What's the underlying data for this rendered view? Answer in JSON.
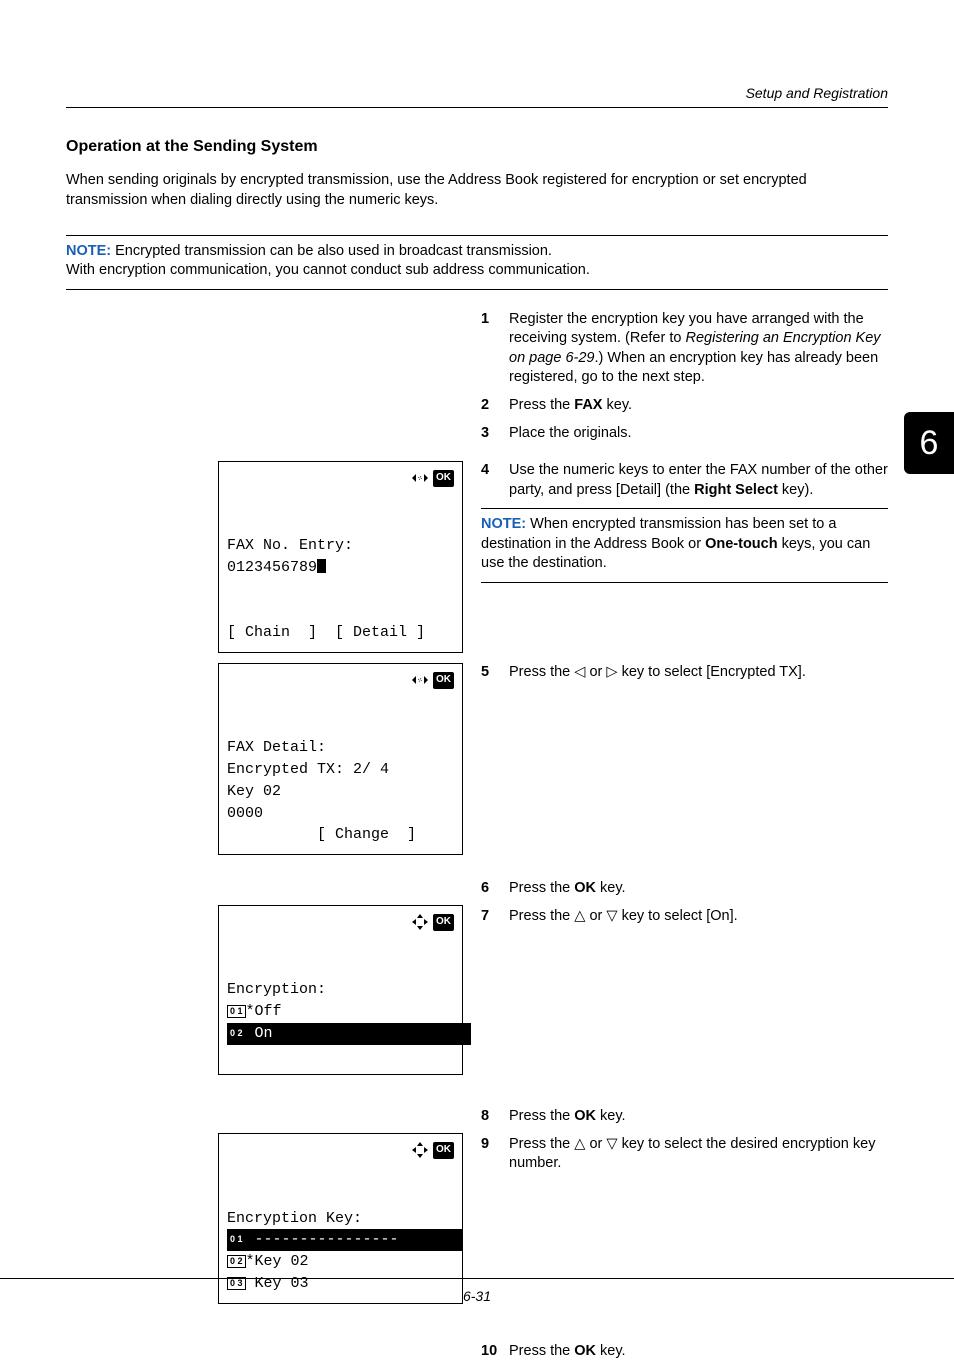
{
  "header": {
    "running_title": "Setup and Registration"
  },
  "tab": {
    "number": "6"
  },
  "section": {
    "title": "Operation at the Sending System"
  },
  "intro": "When sending originals by encrypted transmission, use the Address Book registered for encryption or set encrypted transmission when dialing directly using the numeric keys.",
  "note1": {
    "label": "NOTE:",
    "line1": " Encrypted transmission can be also used in broadcast transmission.",
    "line2": "With encryption communication, you cannot conduct sub address communication."
  },
  "steps": {
    "s1a": "Register the encryption key you have arranged with the receiving system. (Refer to ",
    "s1b": "Registering an Encryption Key on page 6-29",
    "s1c": ".) When an encryption key has already been registered, go to the next step.",
    "s2a": "Press the ",
    "s2b": "FAX",
    "s2c": " key.",
    "s3": "Place the originals.",
    "s4a": "Use the numeric keys to enter the FAX number of the other party, and press [Detail] (the ",
    "s4b": "Right Select",
    "s4c": " key).",
    "s5a": "Press the ",
    "s5b": " or ",
    "s5c": " key to select [Encrypted TX].",
    "s6a": "Press the ",
    "s6b": "OK",
    "s6c": " key.",
    "s7a": "Press the ",
    "s7b": " or ",
    "s7c": " key to select [On].",
    "s8a": "Press the ",
    "s8b": "OK",
    "s8c": " key.",
    "s9a": "Press the ",
    "s9b": " or ",
    "s9c": " key to select the desired encryption key number.",
    "s10a": "Press the ",
    "s10b": "OK",
    "s10c": " key."
  },
  "note2": {
    "label": "NOTE:",
    "text_a": " When encrypted transmission has been set to a destination in the Address Book or ",
    "text_b": "One-touch",
    "text_c": " keys, you can use the destination."
  },
  "lcd1": {
    "ok": "OK",
    "l1": "FAX No. Entry:",
    "l2": "0123456789",
    "l5": "[ Chain  ]  [ Detail ]"
  },
  "lcd2": {
    "ok": "OK",
    "l1": "FAX Detail:",
    "l2": "Encrypted TX: 2/ 4",
    "l3": "Key 02",
    "l4": "0000",
    "l5": "          [ Change  ]"
  },
  "lcd3": {
    "ok": "OK",
    "l1": "Encryption:",
    "n1": "0 1",
    "o1": "*Off",
    "n2": "0 2",
    "o2": " On"
  },
  "lcd4": {
    "ok": "OK",
    "l1": "Encryption Key:",
    "n1": "0 1",
    "o1": " ----------------",
    "n2": "0 2",
    "o2": "*Key 02",
    "n3": "0 3",
    "o3": " Key 03"
  },
  "footer": {
    "page": "6-31"
  },
  "glyphs": {
    "tri_left": "◁",
    "tri_right": "▷",
    "tri_up": "△",
    "tri_down": "▽"
  }
}
